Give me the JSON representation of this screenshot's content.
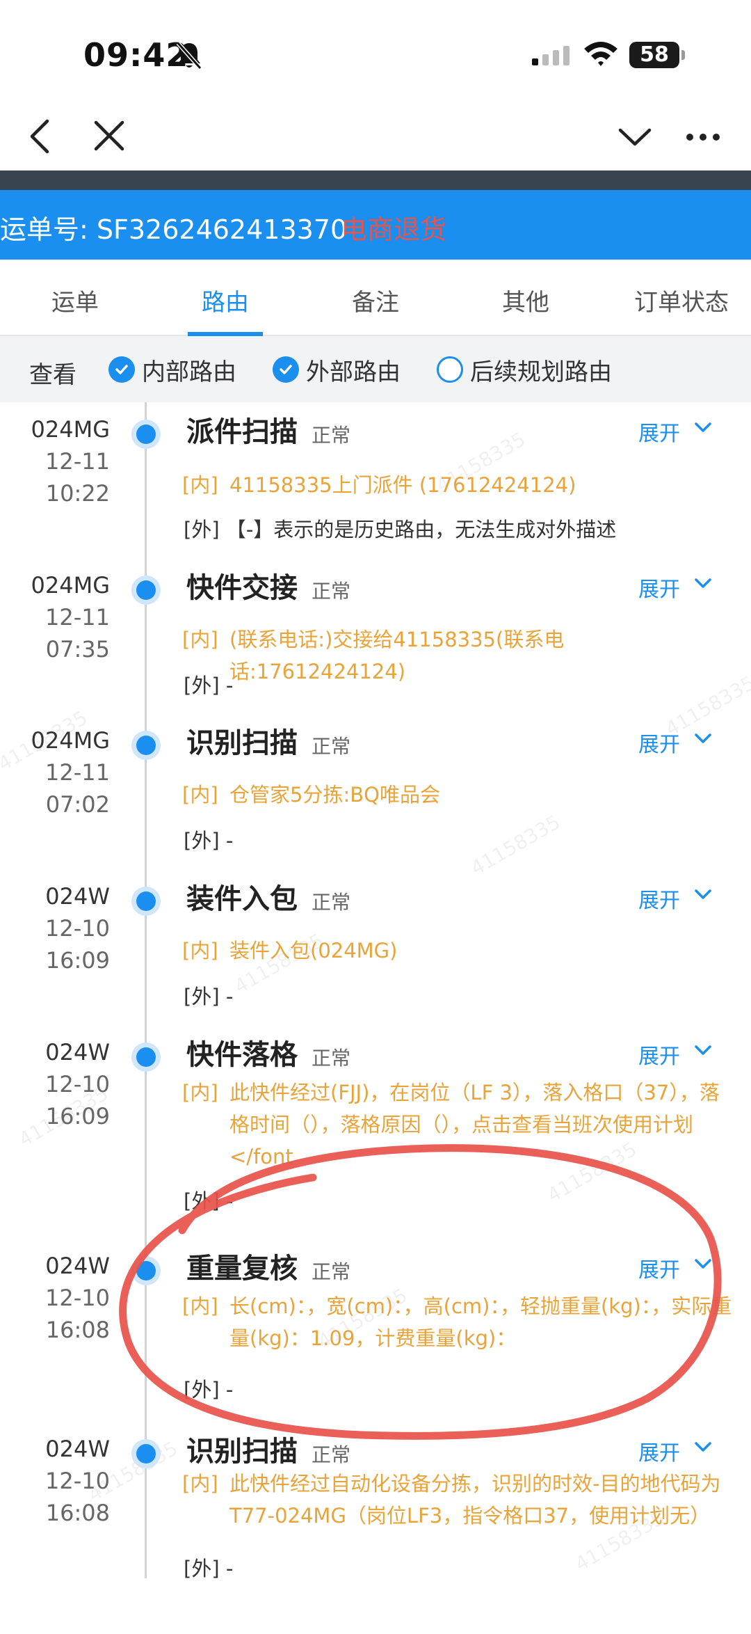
{
  "status_bar": {
    "time": "09:42",
    "battery": "58"
  },
  "nav": {
    "back_icon": "chevron-left-icon",
    "close_icon": "close-icon",
    "dropdown_icon": "chevron-down-icon",
    "more_icon": "more-icon"
  },
  "waybill": {
    "number": "运单号: SF3262462413370",
    "tag": "电商退货"
  },
  "tabs": [
    "运单",
    "路由",
    "备注",
    "其他",
    "订单状态"
  ],
  "active_tab": "路由",
  "filter": {
    "label": "查看",
    "options": [
      {
        "label": "内部路由",
        "checked": true
      },
      {
        "label": "外部路由",
        "checked": true
      },
      {
        "label": "后续规划路由",
        "checked": false
      }
    ]
  },
  "expand_label": "展开",
  "watermark": "41158335",
  "entries": [
    {
      "code": "024MG",
      "date": "12-11",
      "time": "10:22",
      "title": "派件扫描",
      "status": "正常",
      "inner_tag": "[内]",
      "inner": "41158335上门派件 (17612424124)",
      "outer": "[外] 【-】表示的是历史路由，无法生成对外描述"
    },
    {
      "code": "024MG",
      "date": "12-11",
      "time": "07:35",
      "title": "快件交接",
      "status": "正常",
      "inner_tag": "[内]",
      "inner": "(联系电话:)交接给41158335(联系电话:17612424124)",
      "outer": "[外] -"
    },
    {
      "code": "024MG",
      "date": "12-11",
      "time": "07:02",
      "title": "识别扫描",
      "status": "正常",
      "inner_tag": "[内]",
      "inner": "仓管家5分拣:BQ唯品会",
      "outer": "[外] -"
    },
    {
      "code": "024W",
      "date": "12-10",
      "time": "16:09",
      "title": "装件入包",
      "status": "正常",
      "inner_tag": "[内]",
      "inner": "装件入包(024MG)",
      "outer": "[外] -"
    },
    {
      "code": "024W",
      "date": "12-10",
      "time": "16:09",
      "title": "快件落格",
      "status": "正常",
      "inner_tag": "[内]",
      "inner": "此快件经过(FJJ)，在岗位（LF 3），落入格口（37），落格时间（），落格原因（），点击查看当班次使用计划</font",
      "outer": "[外] -"
    },
    {
      "code": "024W",
      "date": "12-10",
      "time": "16:08",
      "title": "重量复核",
      "status": "正常",
      "inner_tag": "[内]",
      "inner": "长(cm)：，宽(cm)：，高(cm)：，轻抛重量(kg)：，实际重量(kg)：1.09，计费重量(kg)：",
      "outer": "[外] -"
    },
    {
      "code": "024W",
      "date": "12-10",
      "time": "16:08",
      "title": "识别扫描",
      "status": "正常",
      "inner_tag": "[内]",
      "inner": "此快件经过自动化设备分拣，识别的时效-目的地代码为T77-024MG（岗位LF3，指令格口37，使用计划无）",
      "outer": "[外] -"
    }
  ],
  "colors": {
    "accent": "#1a8ff0",
    "inner_text": "#e8a43a",
    "tag_red": "#e8534a",
    "annotation": "#e8534a"
  }
}
